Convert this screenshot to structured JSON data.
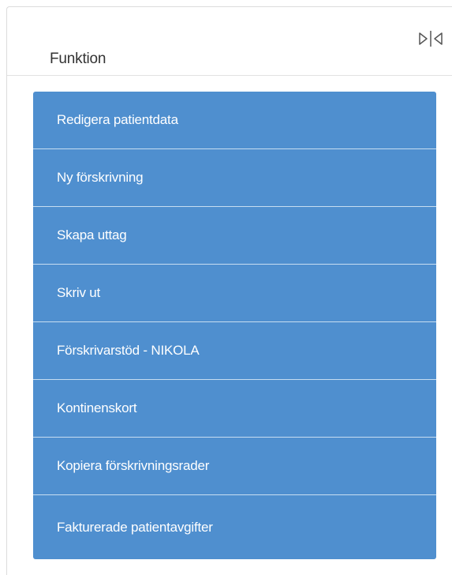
{
  "panel": {
    "title": "Funktion",
    "toggle_icon": "collapse-panel-icon"
  },
  "colors": {
    "accent": "#4f8fcf",
    "divider": "#c7ddf1",
    "text": "#333333"
  },
  "menu": {
    "items": [
      {
        "label": "Redigera patientdata"
      },
      {
        "label": "Ny förskrivning"
      },
      {
        "label": "Skapa uttag"
      },
      {
        "label": "Skriv ut"
      },
      {
        "label": "Förskrivarstöd - NIKOLA"
      },
      {
        "label": "Kontinenskort"
      },
      {
        "label": "Kopiera förskrivningsrader"
      },
      {
        "label": "Fakturerade patientavgifter"
      }
    ]
  }
}
